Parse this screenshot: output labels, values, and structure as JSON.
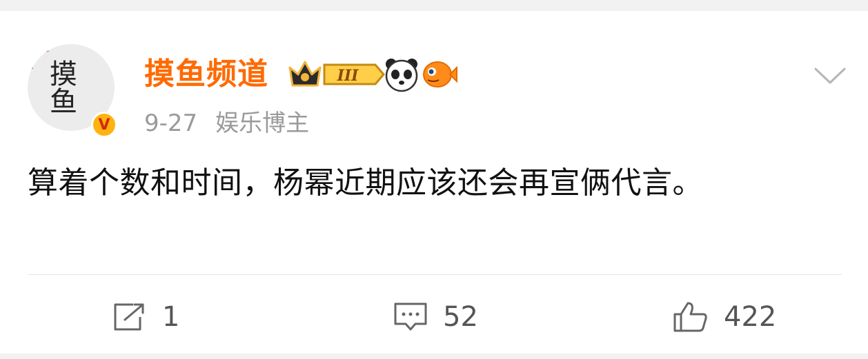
{
  "post": {
    "author": "摸鱼频道",
    "date": "9-27",
    "source": "娱乐博主",
    "content": "算着个数和时间，杨幂近期应该还会再宣俩代言。",
    "avatar_text": "摸鱼",
    "verified_mark": "V",
    "level_badge": "III"
  },
  "actions": {
    "reposts": "1",
    "comments": "52",
    "likes": "422"
  },
  "colors": {
    "author": "#ff6a00",
    "meta": "#9a9a9a",
    "badge": "#ffb30f"
  },
  "icons": [
    "crown-icon",
    "level-badge",
    "panda-icon",
    "fish-icon",
    "chevron-down-icon",
    "repost-icon",
    "comment-icon",
    "like-icon"
  ]
}
